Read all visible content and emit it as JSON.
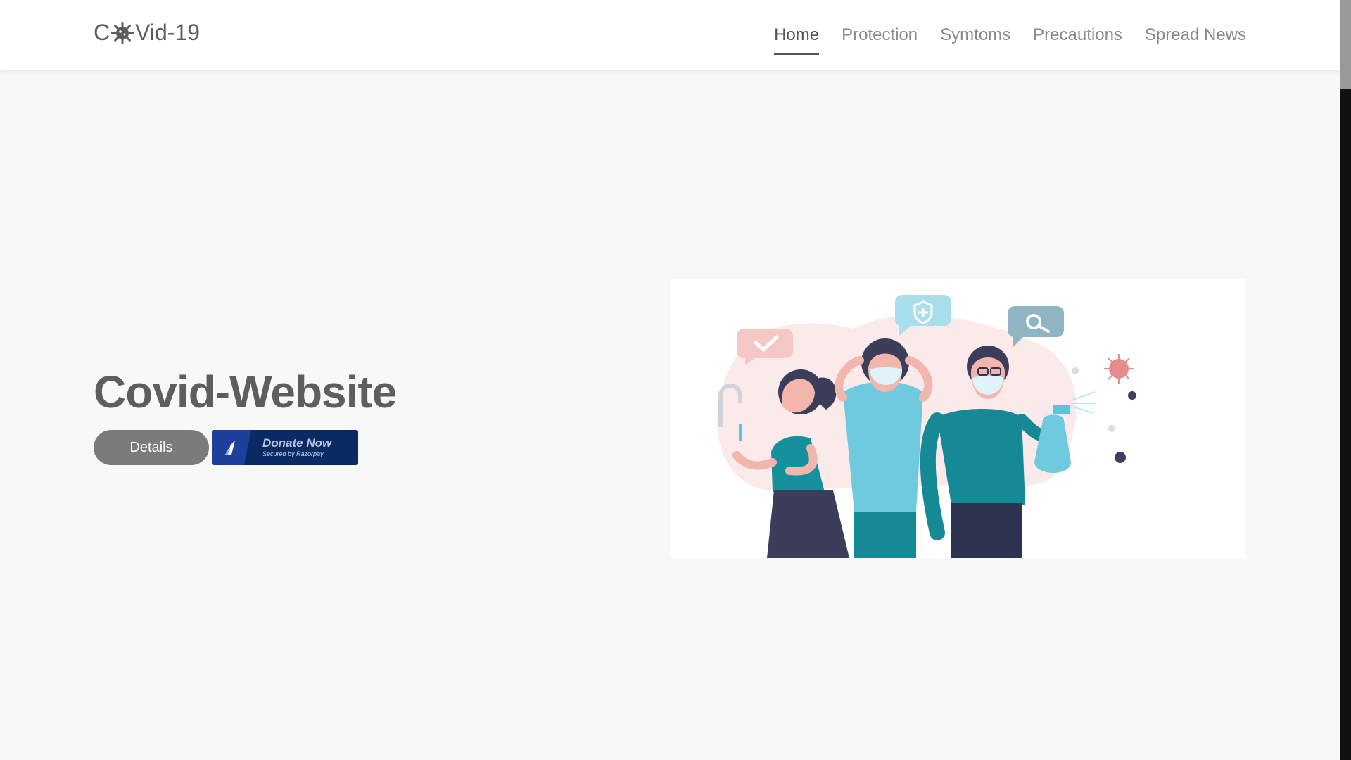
{
  "navbar": {
    "brand_prefix": "C",
    "brand_suffix": "Vid-19",
    "brand_icon": "virus-icon",
    "links": [
      {
        "label": "Home",
        "active": true
      },
      {
        "label": "Protection",
        "active": false
      },
      {
        "label": "Symtoms",
        "active": false
      },
      {
        "label": "Precautions",
        "active": false
      },
      {
        "label": "Spread News",
        "active": false
      }
    ]
  },
  "hero": {
    "title": "Covid-Website",
    "details_label": "Details",
    "donate": {
      "label": "Donate Now",
      "sublabel": "Secured by Razorpay",
      "icon": "razorpay-logo-icon"
    },
    "illustration": "people-wearing-masks-illustration"
  },
  "colors": {
    "page_bg": "#f8f8f8",
    "nav_text": "#8a8a8a",
    "nav_active": "#555555",
    "title": "#5e5e5e",
    "details_button": "#7b7b7b",
    "donate_bg": "#0a2a63",
    "teal": "#158a96",
    "light_blue": "#6fcadf"
  }
}
